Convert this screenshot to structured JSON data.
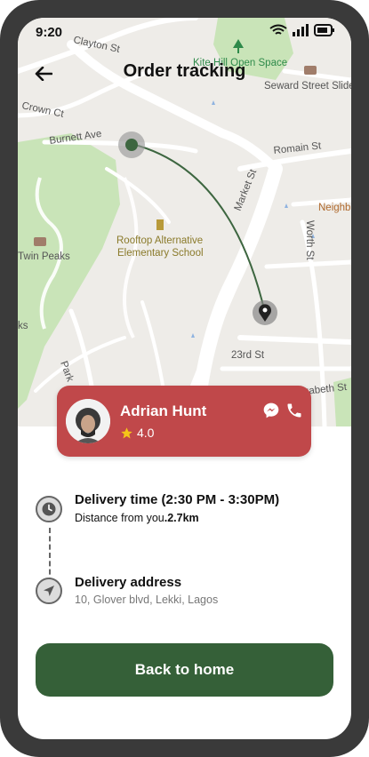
{
  "status_bar": {
    "time": "9:20"
  },
  "header": {
    "title": "Order tracking",
    "back_icon": "arrow-left-icon"
  },
  "map": {
    "labels": {
      "clayton": "Clayton St",
      "kite_hill": "Kite Hill Open Space",
      "seward": "Seward Street Slide",
      "crown": "Crown Ct",
      "burnett": "Burnett Ave",
      "romain": "Romain St",
      "market": "Market St",
      "neighb": "Neighb",
      "worth": "Worth St",
      "school_1": "Rooftop Alternative",
      "school_2": "Elementary School",
      "twin_peaks": "Twin Peaks",
      "ks": "ks",
      "park": "Park",
      "st23": "23rd St",
      "elizabeth": "zabeth St"
    },
    "colors": {
      "base": "#eeece8",
      "park": "#c9e4b8",
      "road": "#ffffff",
      "route": "#3d6640"
    }
  },
  "courier": {
    "name": "Adrian Hunt",
    "rating": "4.0",
    "card_color": "#c0484a",
    "message_icon": "messenger-icon",
    "call_icon": "phone-icon"
  },
  "delivery": {
    "time_title": "Delivery time (2:30 PM - 3:30PM)",
    "distance_label": "Distance from you",
    "distance_value": ".2.7km",
    "address_title": "Delivery address",
    "address_value": "10, Glover blvd, Lekki, Lagos"
  },
  "actions": {
    "back_home": "Back to home",
    "button_color": "#356038"
  }
}
